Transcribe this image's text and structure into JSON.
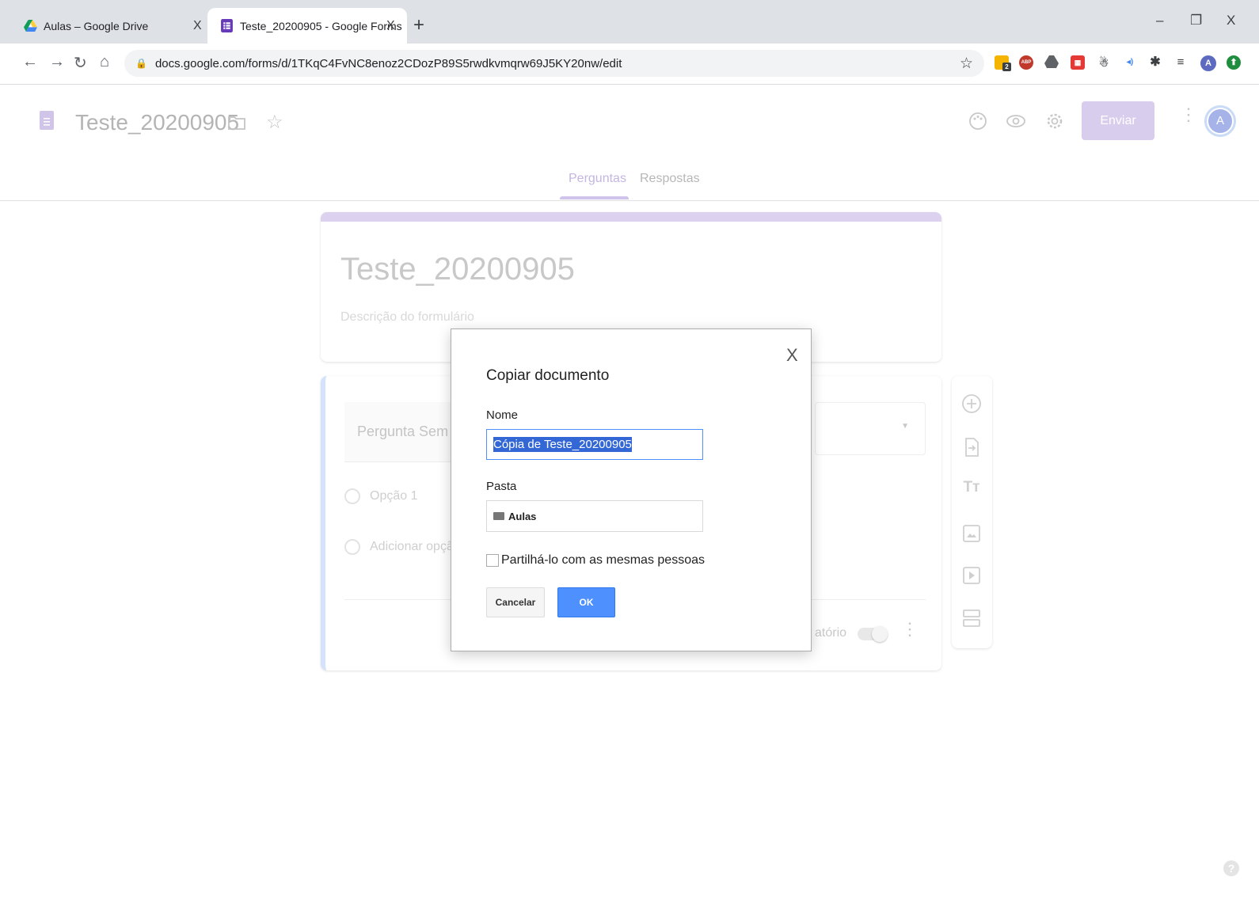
{
  "browser": {
    "tabs": [
      {
        "title": "Aulas – Google Drive",
        "close": "X"
      },
      {
        "title": "Teste_20200905 - Google Forms",
        "close": "X"
      }
    ],
    "new_tab": "+",
    "window_controls": {
      "minimize": "–",
      "maximize": "❐",
      "close": "X"
    },
    "url": "docs.google.com/forms/d/1TKqC4FvNC8enoz2CDozP89S5rwdkvmqrw69J5KY20nw/edit",
    "ext_badge": "2",
    "ext_abp": "ABP",
    "profile_initial": "A"
  },
  "header": {
    "form_name": "Teste_20200905",
    "send_label": "Enviar",
    "avatar_initial": "A",
    "accent": "#673ab7"
  },
  "nav_tabs": {
    "questions": "Perguntas",
    "responses": "Respostas"
  },
  "form": {
    "title": "Teste_20200905",
    "description_placeholder": "Descrição do formulário",
    "question_placeholder": "Pergunta Sem Tít",
    "option1": "Opção 1",
    "add_option": "Adicionar opção",
    "required_fragment": "atório"
  },
  "dialog": {
    "title": "Copiar documento",
    "close": "X",
    "name_label": "Nome",
    "name_value": "Cópia de Teste_20200905",
    "folder_label": "Pasta",
    "folder_value": "Aulas",
    "share_label": "Partilhá-lo com as mesmas pessoas",
    "cancel": "Cancelar",
    "ok": "OK"
  },
  "help": "?"
}
